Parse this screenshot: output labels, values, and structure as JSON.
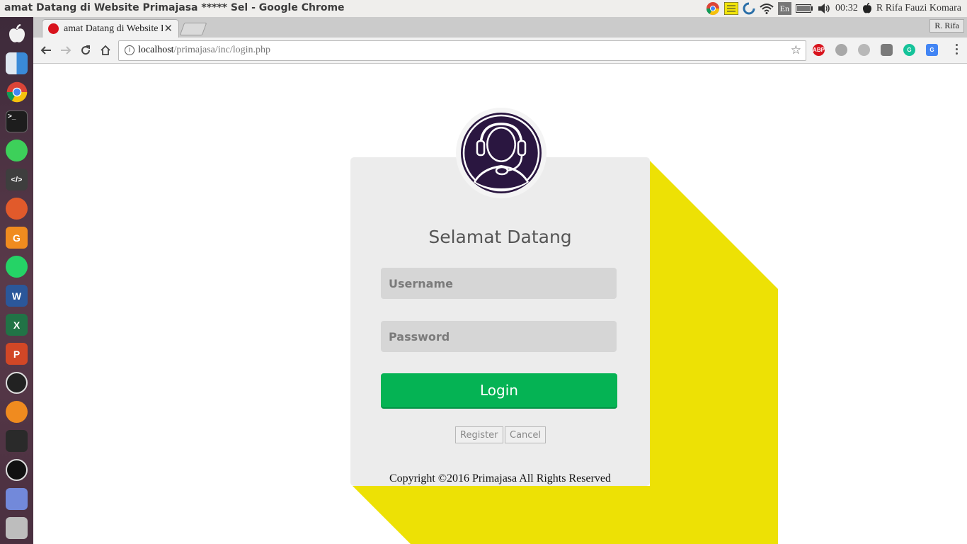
{
  "os": {
    "window_title": "amat Datang di Website Primajasa ***** Sel - Google Chrome",
    "keyboard": "En",
    "time": "00:32",
    "user": "R Rifa Fauzi Komara"
  },
  "browser": {
    "tab_title": "amat Datang di Website Primajasa",
    "profile": "R. Rifa",
    "url_host": "localhost",
    "url_path": "/primajasa/inc/login.php",
    "extensions": [
      "adblock-plus-icon",
      "extension-icon",
      "globe-icon",
      "line-icon",
      "grammarly-icon",
      "google-translate-icon"
    ]
  },
  "launcher": {
    "apps": [
      "apple-icon",
      "finder-icon",
      "chrome-icon",
      "terminal-icon",
      "android-icon",
      "sublime-text-icon",
      "inkscape-icon",
      "foxit-pdf-icon",
      "whatsapp-icon",
      "word-icon",
      "excel-icon",
      "powerpoint-icon",
      "steam-icon",
      "vlc-icon",
      "inkdrop-icon",
      "obs-icon",
      "discord-icon",
      "trash-icon"
    ]
  },
  "login": {
    "heading": "Selamat Datang",
    "username_placeholder": "Username",
    "password_placeholder": "Password",
    "login_label": "Login",
    "register_label": "Register",
    "cancel_label": "Cancel",
    "copyright": "Copyright ©2016 Primajasa All Rights Reserved"
  },
  "colors": {
    "accent_yellow": "#ede105",
    "login_green": "#05b354",
    "avatar_purple": "#2a1640",
    "card_bg": "#ececec"
  }
}
